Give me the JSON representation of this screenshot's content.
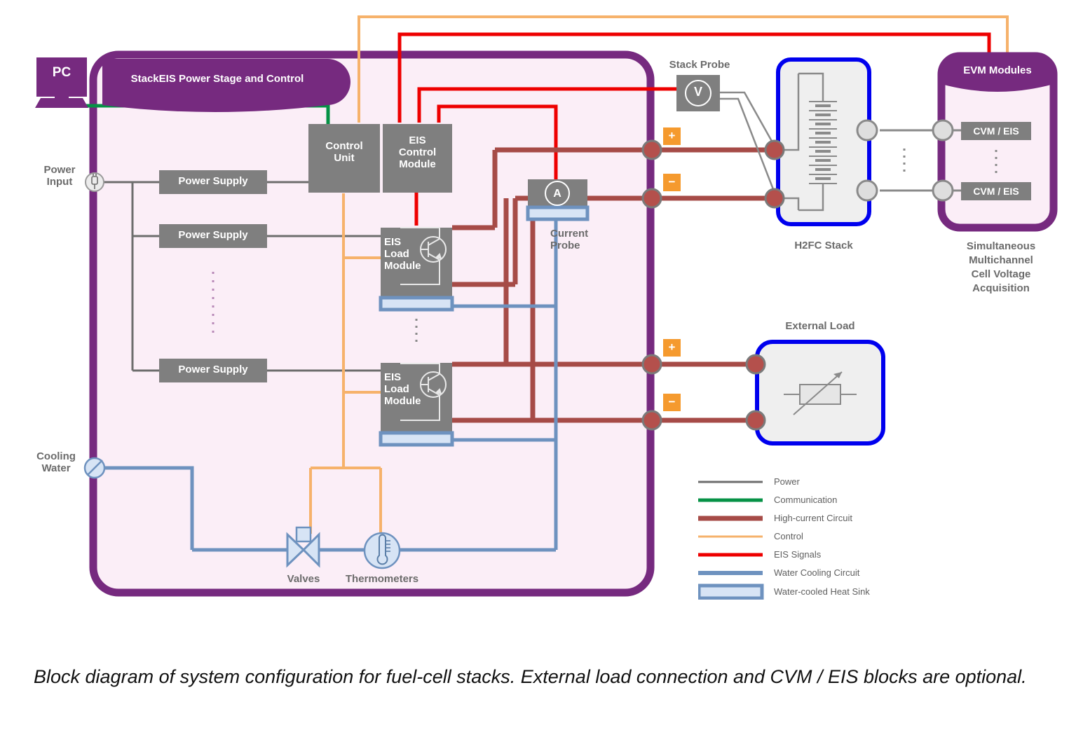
{
  "diagram": {
    "title": "StackEIS Power Stage and Control",
    "caption": "Block diagram of system configuration for fuel-cell stacks. External load connection and CVM / EIS blocks are optional."
  },
  "nodes": {
    "pc": "PC",
    "power_input": "Power\nInput",
    "cooling_water": "Cooling\nWater",
    "power_supply_1": "Power Supply",
    "power_supply_2": "Power Supply",
    "power_supply_3": "Power Supply",
    "control_unit": "Control\nUnit",
    "eis_control_module": "EIS\nControl\nModule",
    "eis_load_module_1": "EIS\nLoad\nModule",
    "eis_load_module_2": "EIS\nLoad\nModule",
    "current_probe": "Current\nProbe",
    "current_probe_symbol": "A",
    "stack_probe": "Stack Probe",
    "stack_probe_symbol": "V",
    "valves": "Valves",
    "thermometers": "Thermometers",
    "h2fc_stack": "H2FC Stack",
    "external_load": "External Load",
    "evm_modules": "EVM Modules",
    "cvm_eis_1": "CVM / EIS",
    "cvm_eis_2": "CVM / EIS",
    "evm_caption": "Simultaneous\nMultichannel\nCell Voltage\nAcquisition",
    "polarity_plus": "+",
    "polarity_minus": "−"
  },
  "legend": {
    "items": [
      {
        "label": "Power",
        "color": "#6d6d6d",
        "kind": "line"
      },
      {
        "label": "Communication",
        "color": "#069246",
        "kind": "line"
      },
      {
        "label": "High-current Circuit",
        "color": "#a64b47",
        "kind": "line"
      },
      {
        "label": "Control",
        "color": "#f6b26b",
        "kind": "line"
      },
      {
        "label": "EIS Signals",
        "color": "#ee0000",
        "kind": "line"
      },
      {
        "label": "Water Cooling Circuit",
        "color": "#6e92bf",
        "kind": "line"
      },
      {
        "label": "Water-cooled Heat Sink",
        "color": "#6e92bf",
        "kind": "swatch",
        "fill": "#d7e4f5"
      }
    ]
  },
  "colors": {
    "purple": "#762a7f",
    "purple_fill": "#fbeef7",
    "gray_box": "#7f7f7f",
    "blue_outline": "#0000ee",
    "orange_badge": "#f59a2e",
    "power": "#6d6d6d",
    "communication": "#069246",
    "high_current": "#a64b47",
    "control": "#f6b26b",
    "eis": "#ee0000",
    "water": "#6e92bf",
    "heatsink": "#d7e4f5"
  }
}
